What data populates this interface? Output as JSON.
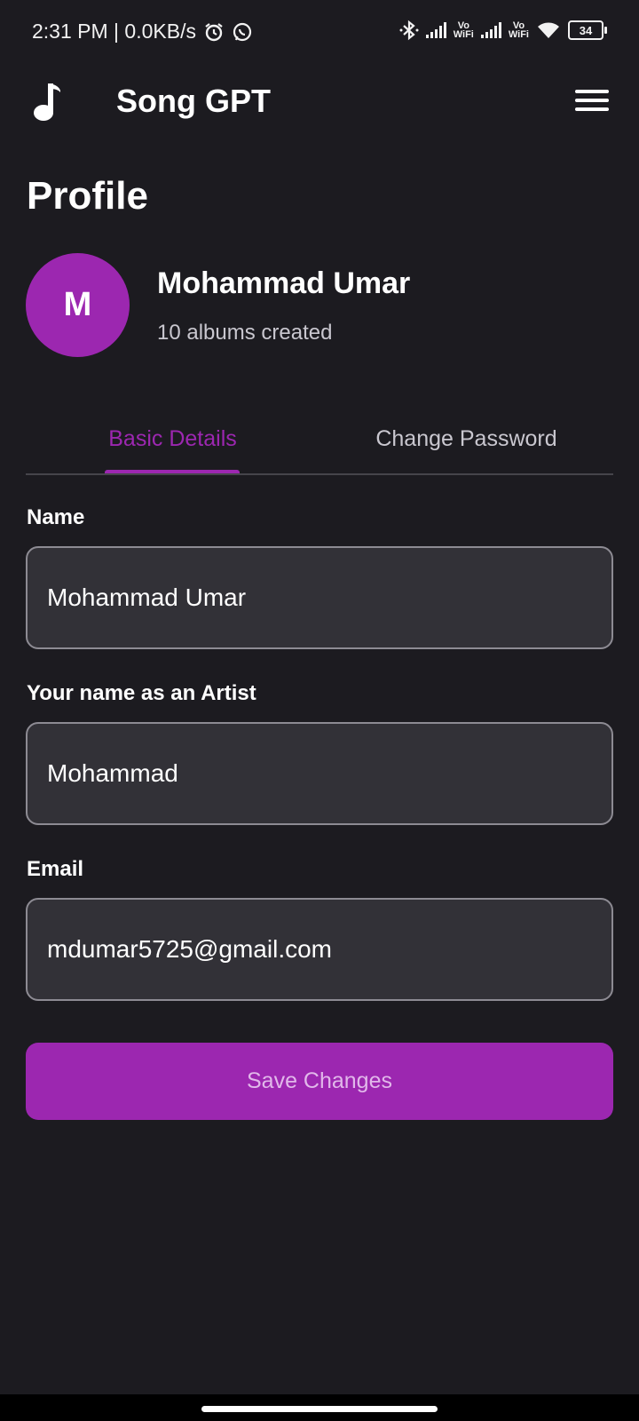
{
  "status_bar": {
    "time_speed": "2:31 PM | 0.0KB/s",
    "vo_label": "Vo",
    "wifi_label": "WiFi",
    "battery": "34"
  },
  "header": {
    "title": "Song GPT",
    "logo_icon": "music-note-icon",
    "menu_icon": "hamburger-menu-icon"
  },
  "page": {
    "title": "Profile"
  },
  "profile": {
    "initial": "M",
    "name": "Mohammad Umar",
    "albums": "10 albums created"
  },
  "tabs": {
    "items": [
      {
        "label": "Basic Details",
        "active": true
      },
      {
        "label": "Change Password",
        "active": false
      }
    ]
  },
  "form": {
    "name_label": "Name",
    "name_value": "Mohammad Umar",
    "artist_label": "Your name as an Artist",
    "artist_value": "Mohammad",
    "email_label": "Email",
    "email_value": "mdumar5725@gmail.com",
    "save_label": "Save Changes"
  },
  "colors": {
    "accent": "#9c27b0",
    "background": "#1c1b20",
    "field_bg": "#323137"
  }
}
